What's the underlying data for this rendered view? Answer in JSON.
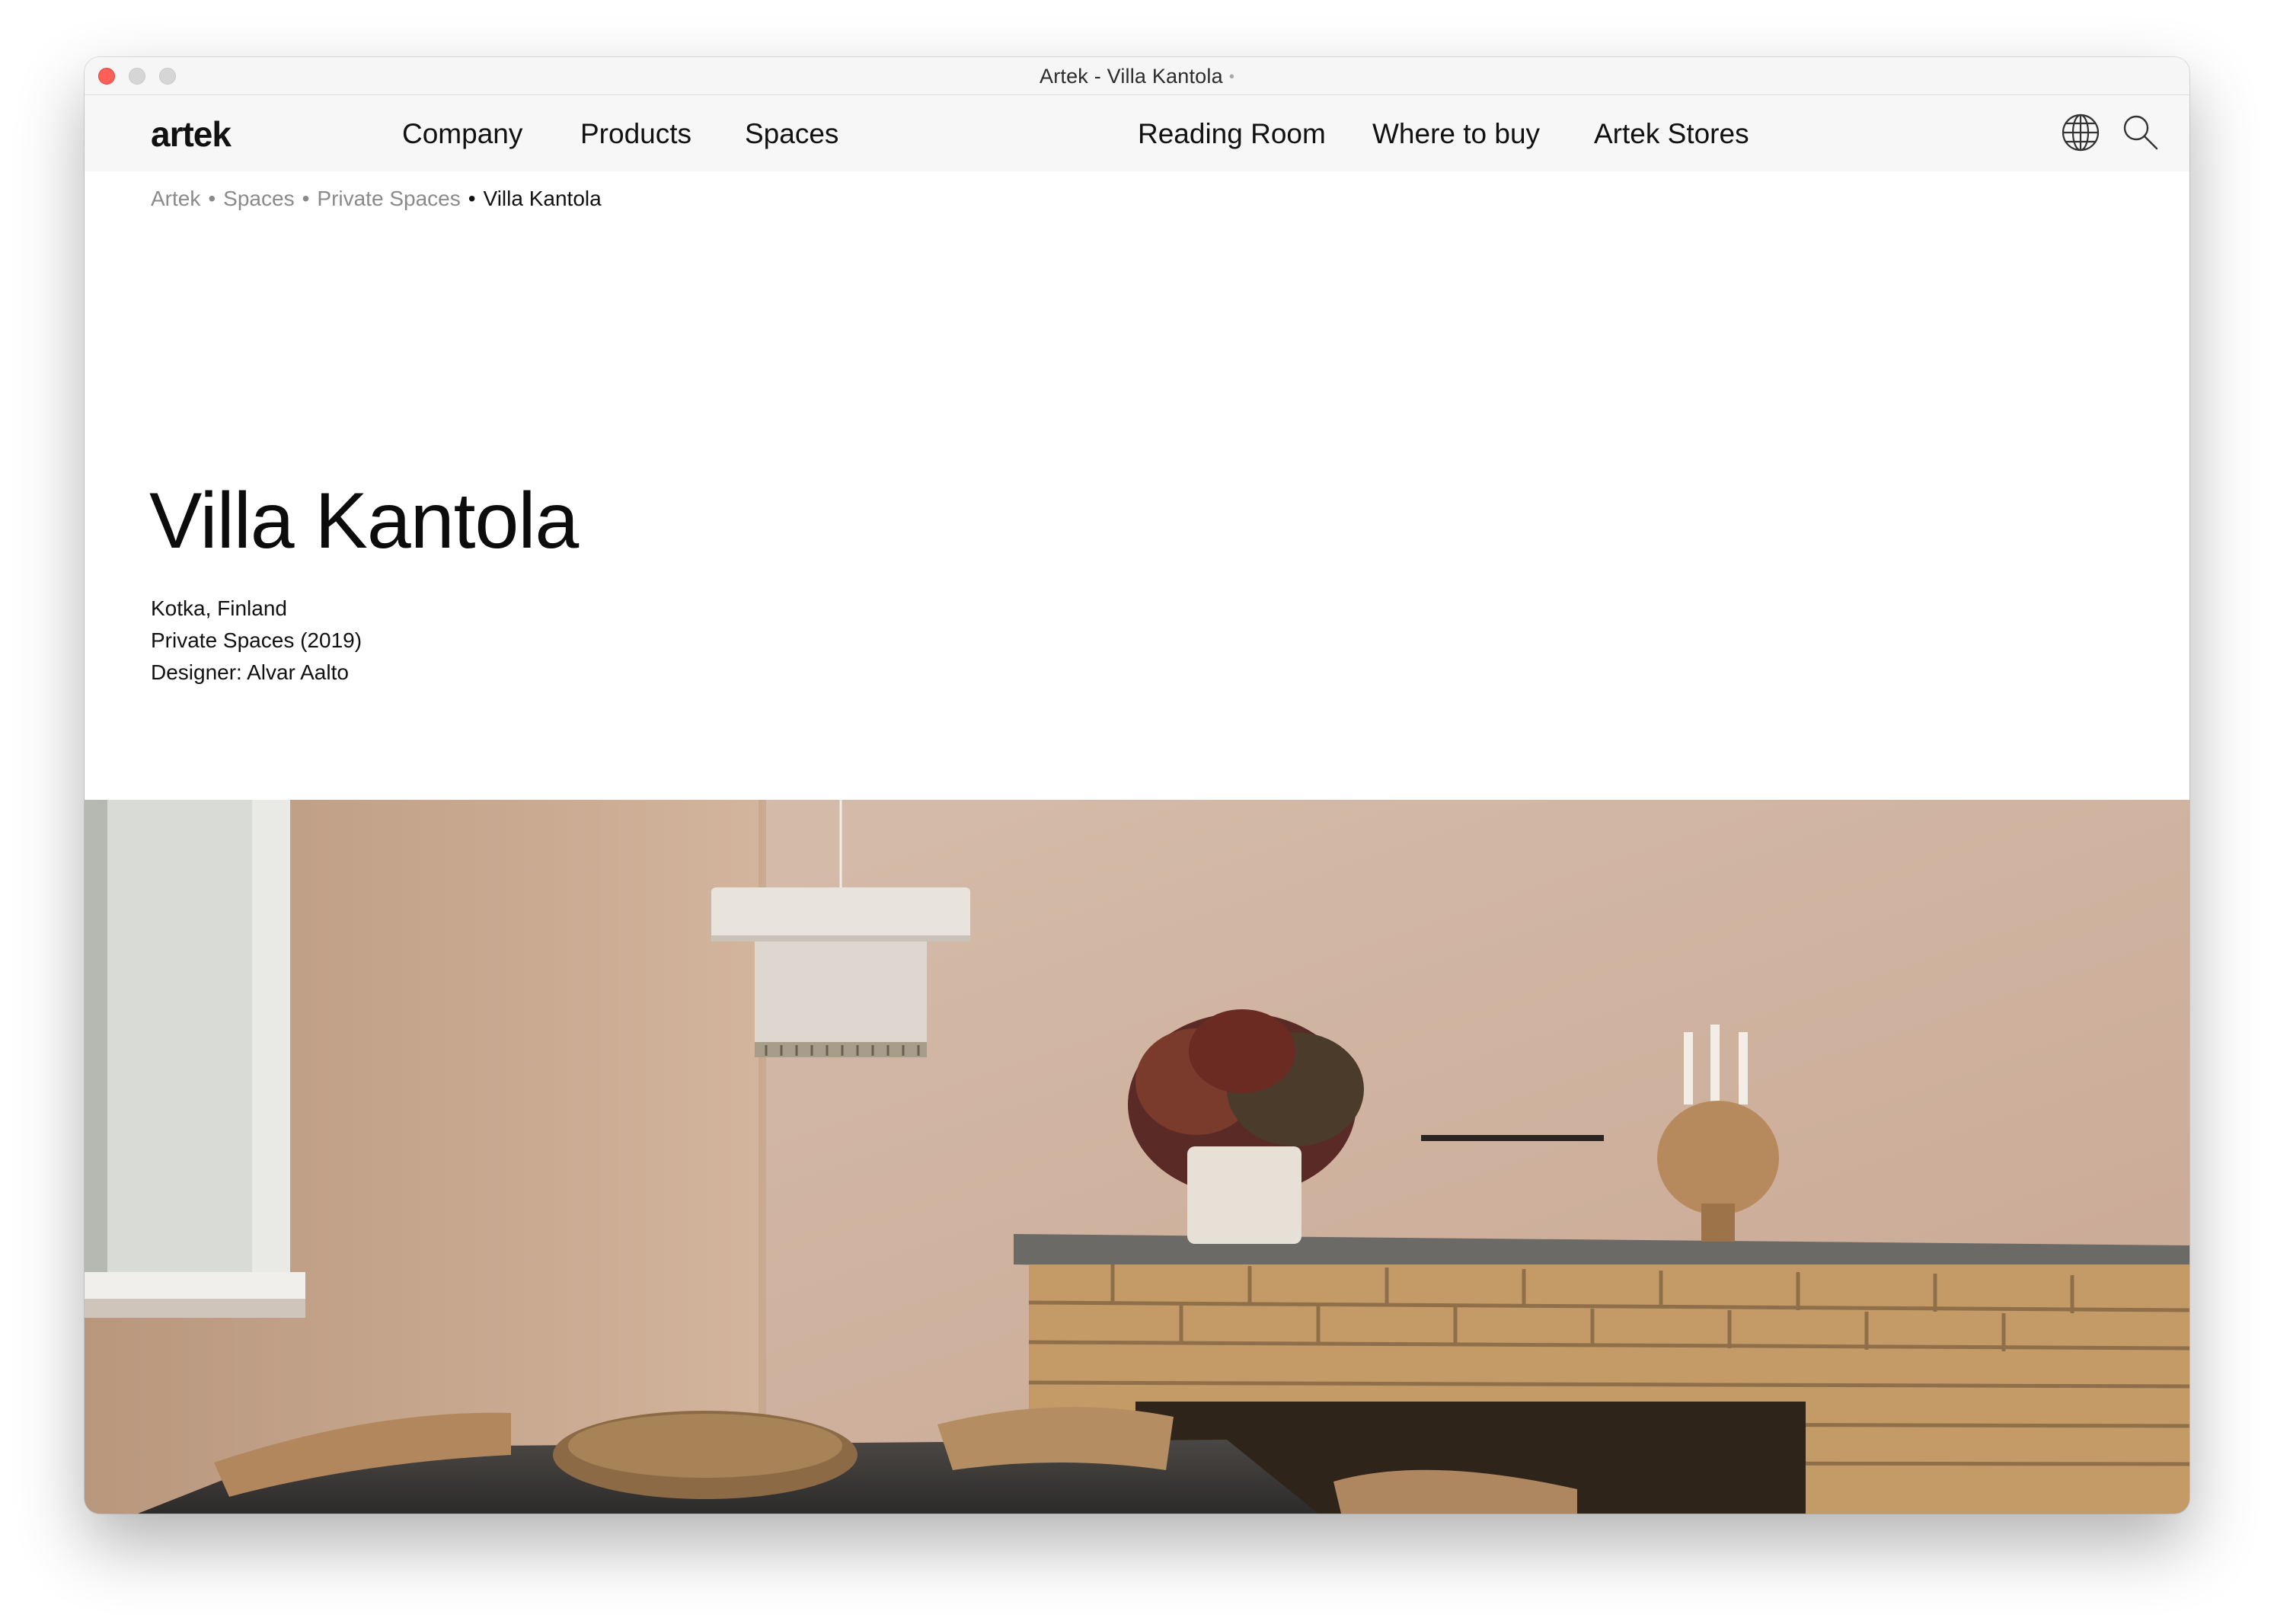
{
  "window": {
    "title": "Artek - Villa Kantola",
    "title_dot": "•"
  },
  "header": {
    "logo": "artek",
    "nav_left": [
      "Company",
      "Products",
      "Spaces"
    ],
    "nav_right": [
      "Reading Room",
      "Where to buy",
      "Artek Stores"
    ],
    "icons": [
      "globe-icon",
      "search-icon"
    ]
  },
  "breadcrumb": {
    "items": [
      "Artek",
      "Spaces",
      "Private Spaces"
    ],
    "current": "Villa Kantola",
    "separator": "•"
  },
  "page": {
    "title": "Villa Kantola",
    "location": "Kotka, Finland",
    "category": "Private Spaces (2019)",
    "designer": "Designer: Alvar Aalto"
  },
  "colors": {
    "close_button": "#fe5f57",
    "header_bg": "#f7f7f7",
    "breadcrumb_muted": "#8a8a8a",
    "text": "#111111"
  }
}
